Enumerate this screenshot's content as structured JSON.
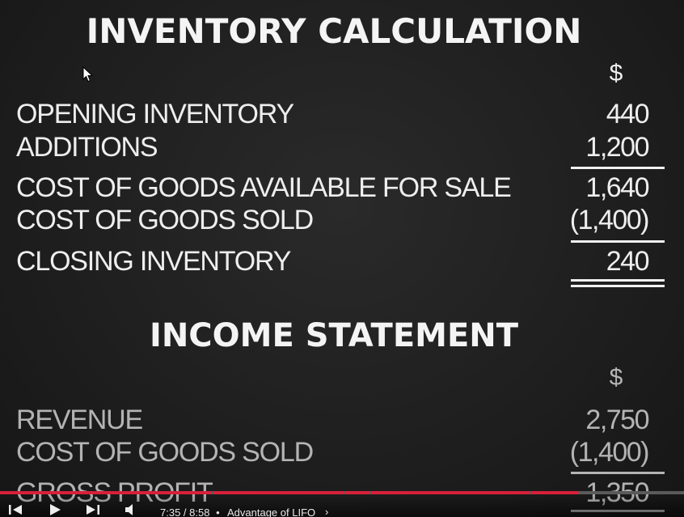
{
  "inventory": {
    "title": "INVENTORY CALCULATION",
    "currency": "$",
    "rows": [
      {
        "label": "OPENING INVENTORY",
        "value": "440"
      },
      {
        "label": "ADDITIONS",
        "value": "1,200"
      },
      {
        "label": "COST OF GOODS AVAILABLE FOR SALE",
        "value": "1,640"
      },
      {
        "label": "COST OF GOODS SOLD",
        "value": "(1,400)"
      },
      {
        "label": "CLOSING INVENTORY",
        "value": "240"
      }
    ]
  },
  "income": {
    "title": "INCOME STATEMENT",
    "currency": "$",
    "rows": [
      {
        "label": "REVENUE",
        "value": "2,750"
      },
      {
        "label": "COST OF GOODS SOLD",
        "value": "(1,400)"
      },
      {
        "label": "GROSS PROFIT",
        "value": "1,350"
      }
    ]
  },
  "player": {
    "time": "7:35 / 8:58",
    "separator": "•",
    "chapter": "Advantage of LIFO",
    "chapter_chevron": "›",
    "progress_fraction": 0.846,
    "accent_color": "#d7203a",
    "icons": [
      "previous-icon",
      "play-icon",
      "next-icon",
      "volume-icon"
    ]
  }
}
